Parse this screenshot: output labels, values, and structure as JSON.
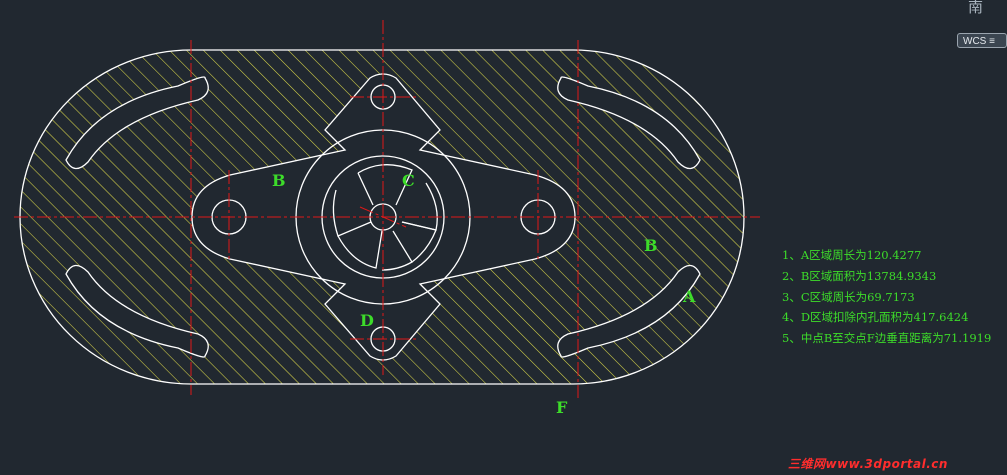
{
  "view_cube": {
    "compass_char": "南",
    "wcs_label": "WCS ≡"
  },
  "labels": {
    "B_top": "B",
    "C": "C",
    "D": "D",
    "B_right": "B",
    "A": "A",
    "F": "F"
  },
  "notes": [
    "1、A区域周长为120.4277",
    "2、B区域面积为13784.9343",
    "3、C区域周长为69.7173",
    "4、D区域扣除内孔面积为417.6424",
    "5、中点B至交点F边垂直距离为71.1919"
  ],
  "watermark": "三维网www.3dportal.cn",
  "colors": {
    "background": "#212830",
    "geometry": "#ffffff",
    "hatch": "#d8d64a",
    "centerline": "#e01818",
    "text": "#3ddc2a",
    "watermark": "#ff2d2d"
  }
}
